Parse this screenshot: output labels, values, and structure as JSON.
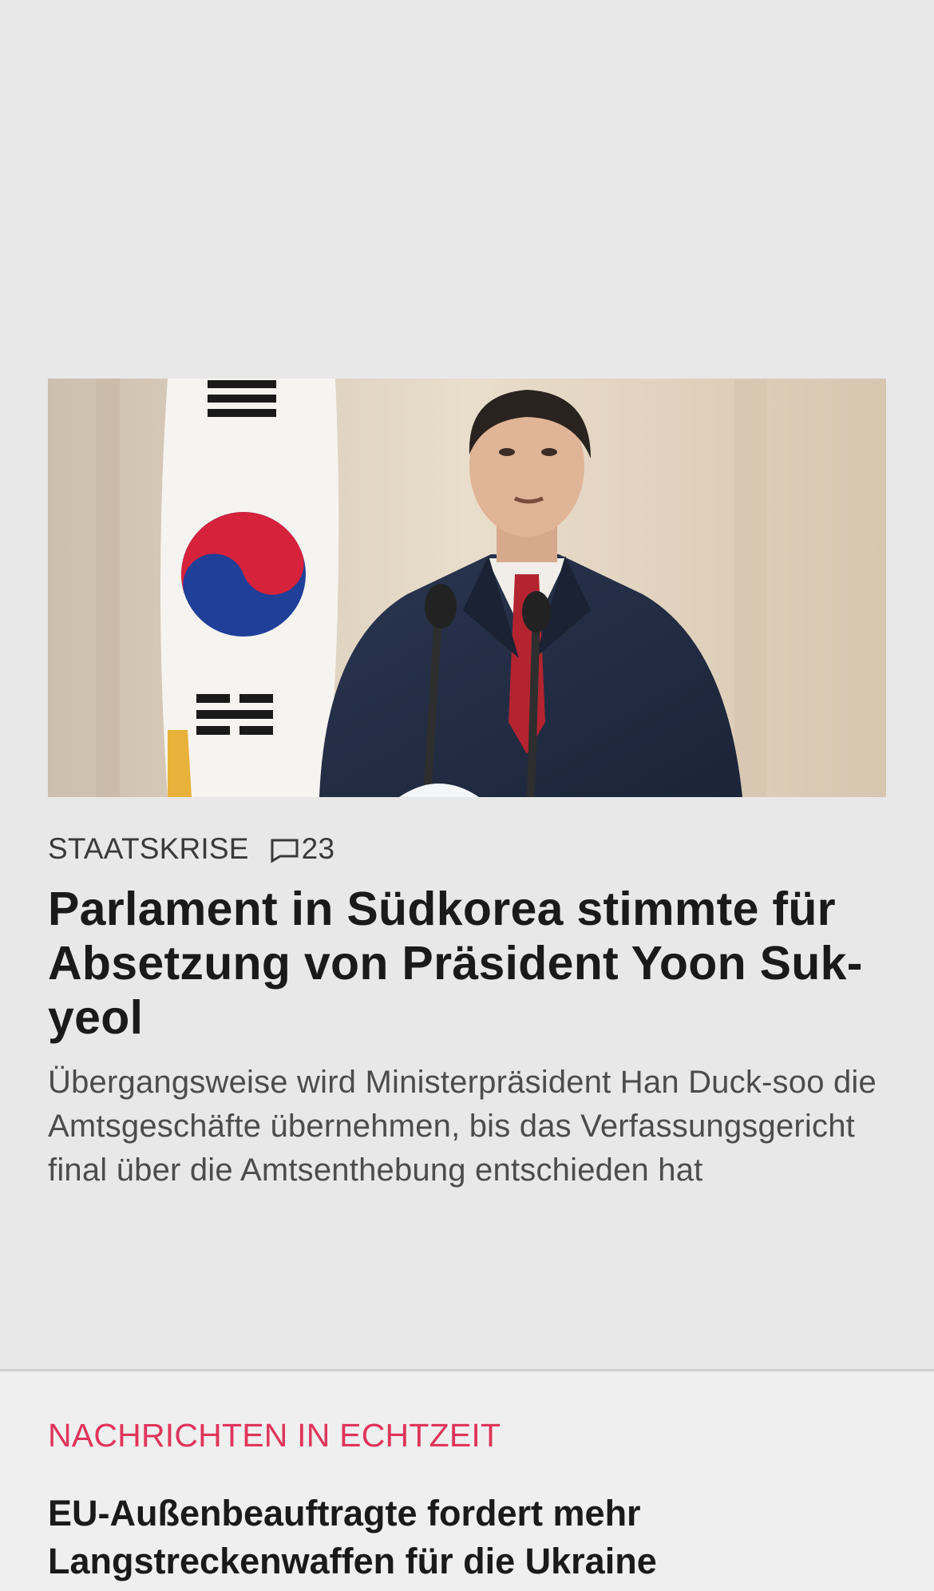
{
  "article": {
    "image_alt": "Südkoreas Präsident Yoon Suk-yeol am Rednerpult vor südkoreanischer Flagge",
    "kicker": "STAATSKRISE",
    "comment_count": "23",
    "comment_icon": "comment-bubble-icon",
    "headline": "Parlament in Südkorea stimmte für Absetzung von Präsident Yoon Suk-yeol",
    "teaser": "Übergangsweise wird Ministerpräsident Han Duck-soo die Amtsgeschäfte übernehmen, bis das Verfassungsgericht final über die Amtsenthebung entschieden hat"
  },
  "live": {
    "title": "NACHRICHTEN IN ECHTZEIT",
    "items": [
      {
        "headline": "EU-Außenbeauftragte fordert mehr Langstreckenwaffen für die Ukraine"
      }
    ]
  },
  "colors": {
    "background": "#e8e8e8",
    "live_background": "#efefef",
    "accent": "#e0355b",
    "headline": "#1a1a1a",
    "teaser": "#4c4c4c"
  }
}
